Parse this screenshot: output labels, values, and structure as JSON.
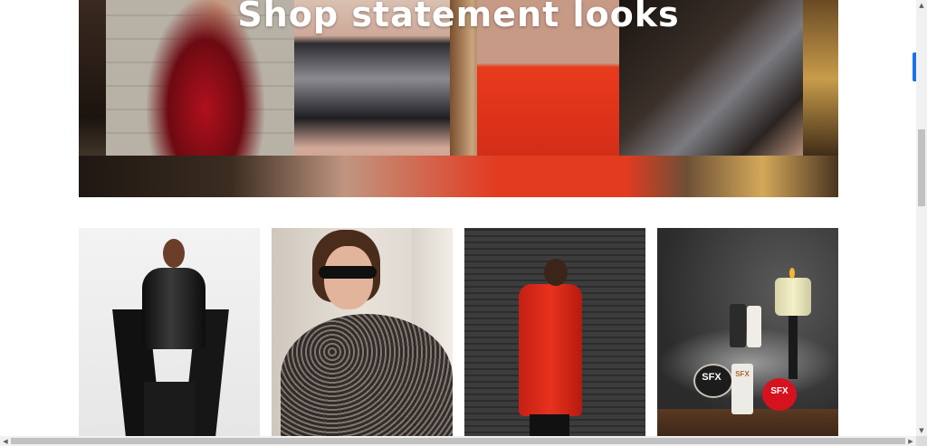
{
  "hero": {
    "title": "Shop statement looks"
  },
  "tiles": [
    {
      "name": "leather-look-tile"
    },
    {
      "name": "lace-top-tile"
    },
    {
      "name": "red-coat-tile"
    },
    {
      "name": "sfx-makeup-tile",
      "product_labels": {
        "box": "SFX",
        "tube": "SFX",
        "red": "SFX"
      }
    }
  ],
  "scrollbars": {
    "up_arrow": "▲",
    "down_arrow": "▼",
    "left_arrow": "◀",
    "right_arrow": "▶"
  },
  "colors": {
    "hero_title": "#ffffff",
    "accent_tab": "#1a73e8",
    "scroll_thumb": "#c1c1c1"
  }
}
